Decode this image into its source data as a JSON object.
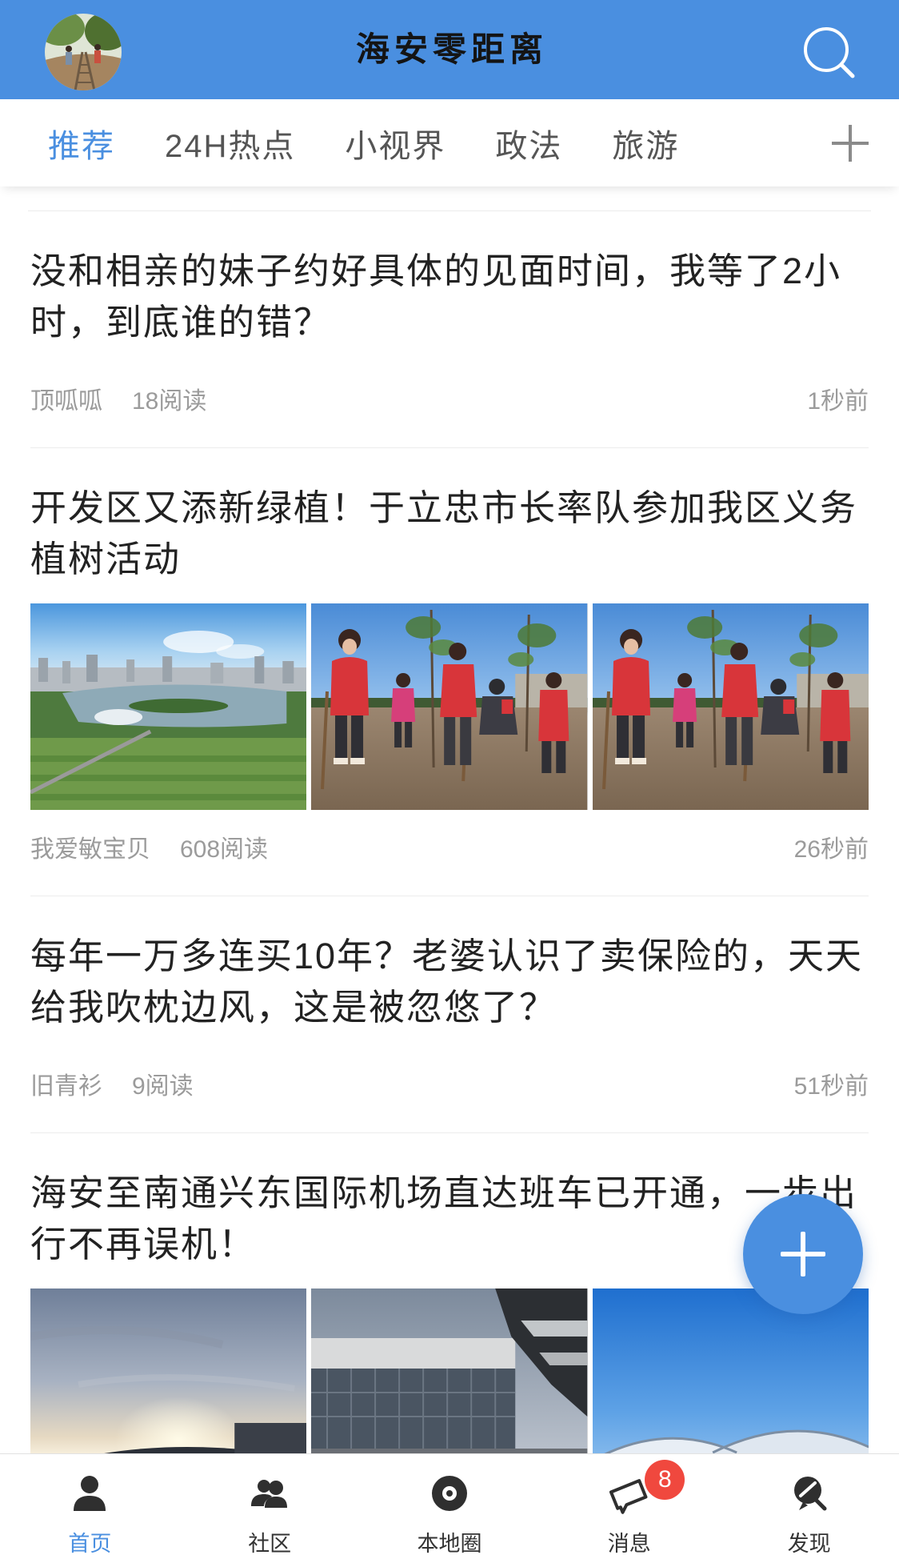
{
  "app": {
    "title": "海安零距离"
  },
  "header": {
    "search_icon": "search-icon"
  },
  "tabs": {
    "items": [
      {
        "label": "推荐",
        "active": true
      },
      {
        "label": "24H热点",
        "active": false
      },
      {
        "label": "小视界",
        "active": false
      },
      {
        "label": "政法",
        "active": false
      },
      {
        "label": "旅游",
        "active": false
      }
    ],
    "add_icon": "plus-icon"
  },
  "feed": [
    {
      "title": "没和相亲的妹子约好具体的见面时间，我等了2小时，到底谁的错？",
      "author": "顶呱呱",
      "reads": "18阅读",
      "time": "1秒前"
    },
    {
      "title": "开发区又添新绿植！于立忠市长率队参加我区义务植树活动",
      "author": "我爱敏宝贝",
      "reads": "608阅读",
      "time": "26秒前"
    },
    {
      "title": "每年一万多连买10年？老婆认识了卖保险的，天天给我吹枕边风，这是被忽悠了？",
      "author": "旧青衫",
      "reads": "9阅读",
      "time": "51秒前"
    },
    {
      "title": "海安至南通兴东国际机场直达班车已开通，一步出行不再误机！"
    }
  ],
  "fab": {
    "icon": "plus-icon"
  },
  "bottom_nav": {
    "items": [
      {
        "label": "首页",
        "icon": "home-person-icon",
        "active": true
      },
      {
        "label": "社区",
        "icon": "community-icon",
        "active": false
      },
      {
        "label": "本地圈",
        "icon": "disc-icon",
        "active": false
      },
      {
        "label": "消息",
        "icon": "message-icon",
        "active": false,
        "badge": "8"
      },
      {
        "label": "发现",
        "icon": "discover-icon",
        "active": false
      }
    ]
  },
  "colors": {
    "brand": "#4a8fe0",
    "badge": "#f0483e"
  }
}
